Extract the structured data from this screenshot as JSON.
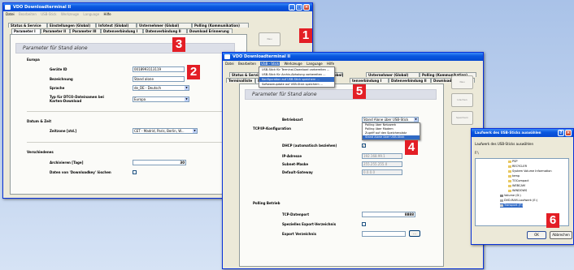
{
  "win1": {
    "title": "VDO Downloadterminal II",
    "menu": [
      "Datei",
      "Bearbeiten",
      "USB-Stick",
      "Werkzeuge",
      "Language",
      "Hilfe"
    ],
    "tabs_row1": [
      "Status & Service",
      "Einstellungen (Global)",
      "Infotext (Global)",
      "Unternehmer (Global)",
      "Polling (Kommunikation)"
    ],
    "tabs_row2": [
      "Parameter I",
      "Parameter II",
      "Parameter III",
      "Datenverbindung I",
      "Datenverbindung II",
      "Download Erinnerung"
    ],
    "header": "Parameter für Stand alone",
    "sections": {
      "europa": "Europa",
      "datum": "Datum & Zeit",
      "verschiedenes": "Verschiedenes"
    },
    "fields": {
      "geraete_id_label": "Geräte ID",
      "geraete_id": "0018993113119",
      "bezeichnung_label": "Bezeichnung",
      "bezeichnung": "Stand alone",
      "sprache_label": "Sprache",
      "sprache": "de_DE - Deutsch",
      "typ_label": "Typ für DTCO-Dateinamen bei Karten-Download",
      "typ": "Europa",
      "zeitzone_label": "Zeitzone [std.]",
      "zeitzone": "CET - Madrid, Paris, Berlin, W...",
      "archivieren_label": "Archivieren [Tage]",
      "archivieren": "30",
      "daten_label": "Daten von 'Downloadkey' löschen"
    },
    "side_button": "Neu"
  },
  "win2": {
    "title": "VDO Downloadterminal II",
    "menu": [
      "Datei",
      "Bearbeiten",
      "USB - Stick",
      "Werkzeuge",
      "Language",
      "Hilfe"
    ],
    "usb_menu": [
      "USB-Stick für Terminal-Download vorbereiten ...",
      "USB-Stick für Archiv-Abholung vorbereiten ...",
      "Konfiguration auf USB-Stick speichern ...",
      "Softwareupdate auf USB-Stick speichern ..."
    ],
    "usb_menu_highlight_index": 2,
    "tabs_row1": [
      "Status & Service",
      "Einstellungen (Global)",
      "Infotext (Global)",
      "Unternehmer (Global)",
      "Polling (Kommunikation)"
    ],
    "tabs_row2": [
      "Terminalliste",
      "Param",
      "tenverbindung I",
      "Datenverbindung II",
      "Download Erinnerung"
    ],
    "header": "Parameter für Stand alone",
    "betriebsart_label": "Betriebsart",
    "betriebsart": "Stand Alone über USB-Stick",
    "betriebsart_options": [
      "Polling über Netzwerk",
      "Polling über Modem",
      "Zugriff auf den Speicherplatz",
      "Stand Alone über USB-Stick"
    ],
    "section_tcp": "TCP/IP-Konfiguration",
    "dhcp_label": "DHCP (automatisch beziehen)",
    "ip_label": "IP-Adresse",
    "ip": "192.168.99.1",
    "subnet_label": "Subnet-Maske",
    "subnet": "255.255.255.0",
    "gateway_label": "Default-Gateway",
    "gateway": "0.0.0.0",
    "section_polling": "Polling Betrieb",
    "tcp_port_label": "TCP-Datenport",
    "tcp_port": "8888",
    "spez_label": "Spezielles Export-Verzeichnis",
    "export_label": "Export Verzeichnis",
    "browse": "...",
    "side_buttons": [
      "Neu",
      "Löschen",
      "Speichern"
    ]
  },
  "dialog": {
    "title": "Laufwerk des USB-Sticks auswählen",
    "prompt": "Laufwerk des USB-Sticks auswählen",
    "drive": "F:\\",
    "tree": [
      "PSP",
      "RECYCLER",
      "System Volume Information",
      "temp",
      "TOCompact",
      "WEBCAM",
      "WINDOWS",
      "Volume (D:)",
      "DVD-RAM-Laufwerk (E:)",
      "Transport (F:)"
    ],
    "tree_highlight_index": 9,
    "ok": "OK",
    "cancel": "Abbrechen"
  },
  "badges": [
    "1",
    "2",
    "3",
    "4",
    "5",
    "6"
  ],
  "colors": {
    "badge": "#e31e25",
    "titlebar": "#0a58e0",
    "highlight": "#316ac5"
  }
}
